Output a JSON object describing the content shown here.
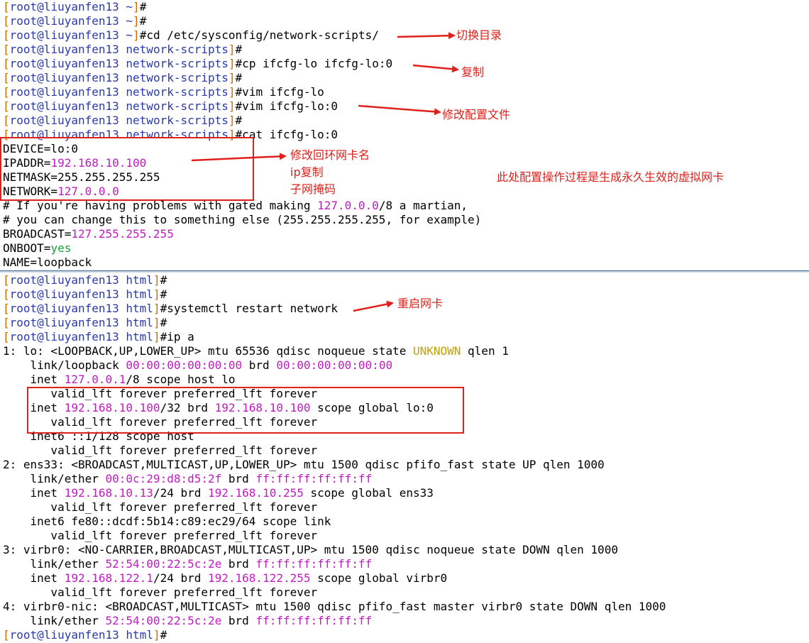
{
  "terminal_top": {
    "prompt_user": "root",
    "prompt_host": "liuyanfen13",
    "lines": [
      {
        "dir": "~",
        "cmd": ""
      },
      {
        "dir": "~",
        "cmd": ""
      },
      {
        "dir": "~",
        "cmd": "cd /etc/sysconfig/network-scripts/"
      },
      {
        "dir": "network-scripts",
        "cmd": ""
      },
      {
        "dir": "network-scripts",
        "cmd": "cp ifcfg-lo ifcfg-lo:0"
      },
      {
        "dir": "network-scripts",
        "cmd": ""
      },
      {
        "dir": "network-scripts",
        "cmd": "vim ifcfg-lo"
      },
      {
        "dir": "network-scripts",
        "cmd": "vim ifcfg-lo:0"
      },
      {
        "dir": "network-scripts",
        "cmd": ""
      },
      {
        "dir": "network-scripts",
        "cmd": "cat ifcfg-lo:0"
      }
    ],
    "cfg": {
      "device": "DEVICE=lo:0",
      "ipaddr_key": "IPADDR=",
      "ipaddr_val": "192.168.10.100",
      "netmask": "NETMASK=255.255.255.255",
      "network_key": "NETWORK=",
      "network_val": "127.0.0.0",
      "comment1_a": "# If you're having problems with gated making ",
      "comment1_ip": "127.0.0.0",
      "comment1_b": "/8 a martian,",
      "comment2": "# you can change this to something else (255.255.255.255, for example)",
      "broadcast_key": "BROADCAST=",
      "broadcast_val": "127.255.255.255",
      "onboot_key": "ONBOOT=",
      "onboot_val": "yes",
      "name": "NAME=loopback"
    }
  },
  "terminal_bottom": {
    "lines": [
      {
        "dir": "html",
        "cmd": ""
      },
      {
        "dir": "html",
        "cmd": ""
      },
      {
        "dir": "html",
        "cmd": "systemctl restart network"
      },
      {
        "dir": "html",
        "cmd": ""
      },
      {
        "dir": "html",
        "cmd": "ip a"
      }
    ],
    "output": {
      "lo_head_a": "1: lo: <LOOPBACK,UP,LOWER_UP> mtu 65536 qdisc noqueue state ",
      "lo_state": "UNKNOWN",
      "lo_head_b": " qlen 1",
      "lo_link_a": "    link/loopback ",
      "lo_mac": "00:00:00:00:00:00",
      "lo_link_b": " brd ",
      "lo_brd": "00:00:00:00:00:00",
      "lo_inet_a": "    inet ",
      "lo_inet_ip": "127.0.0.1",
      "lo_inet_b": "/8 scope host lo",
      "valid1": "       valid_lft forever preferred_lft forever",
      "lo0_inet_a": "    inet ",
      "lo0_ip": "192.168.10.100",
      "lo0_mid": "/32 brd ",
      "lo0_brd": "192.168.10.100",
      "lo0_tail": " scope global lo:0",
      "valid2": "       valid_lft forever preferred_lft forever",
      "lo_inet6": "    inet6 ::1/128 scope host",
      "valid3": "       valid_lft forever preferred_lft forever",
      "ens_head": "2: ens33: <BROADCAST,MULTICAST,UP,LOWER_UP> mtu 1500 qdisc pfifo_fast state UP qlen 1000",
      "ens_link_a": "    link/ether ",
      "ens_mac": "00:0c:29:d8:d5:2f",
      "ens_link_b": " brd ",
      "ens_brd": "ff:ff:ff:ff:ff:ff",
      "ens_inet_a": "    inet ",
      "ens_ip": "192.168.10.13",
      "ens_mid": "/24 brd ",
      "ens_bcast": "192.168.10.255",
      "ens_tail": " scope global ens33",
      "valid4": "       valid_lft forever preferred_lft forever",
      "ens_inet6": "    inet6 fe80::dcdf:5b14:c89:ec29/64 scope link",
      "valid5": "       valid_lft forever preferred_lft forever",
      "virbr_head": "3: virbr0: <NO-CARRIER,BROADCAST,MULTICAST,UP> mtu 1500 qdisc noqueue state DOWN qlen 1000",
      "virbr_link_a": "    link/ether ",
      "virbr_mac": "52:54:00:22:5c:2e",
      "virbr_link_b": " brd ",
      "virbr_brd": "ff:ff:ff:ff:ff:ff",
      "virbr_inet_a": "    inet ",
      "virbr_ip": "192.168.122.1",
      "virbr_mid": "/24 brd ",
      "virbr_bcast": "192.168.122.255",
      "virbr_tail": " scope global virbr0",
      "valid6": "       valid_lft forever preferred_lft forever",
      "nic_head": "4: virbr0-nic: <BROADCAST,MULTICAST> mtu 1500 qdisc pfifo_fast master virbr0 state DOWN qlen 1000",
      "nic_link_a": "    link/ether ",
      "nic_mac": "52:54:00:22:5c:2e",
      "nic_link_b": " brd ",
      "nic_brd": "ff:ff:ff:ff:ff:ff"
    },
    "final_prompt_dir": "html"
  },
  "annotations": {
    "switch_dir": "切换目录",
    "copy": "复制",
    "edit_config": "修改配置文件",
    "rename_loopback": "修改回环网卡名",
    "ip_copy": "ip复制",
    "subnet_mask": "子网掩码",
    "summary": "此处配置操作过程是生成永久生效的虚拟网卡",
    "restart_nic": "重启网卡"
  },
  "colors": {
    "prompt_bracket": "#cc6b00",
    "prompt_user": "#2a3aa8",
    "value_magenta": "#c01cc0",
    "state_yellow": "#c4a000",
    "yes_green": "#11a33a",
    "annotation_red": "#e0201a"
  }
}
